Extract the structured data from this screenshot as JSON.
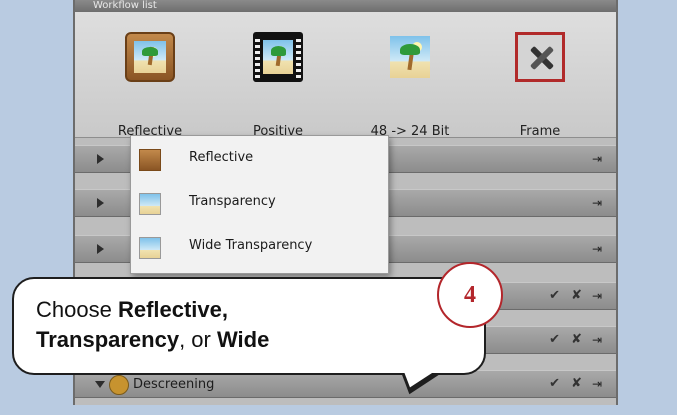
{
  "header": {
    "title": "Workflow list"
  },
  "toolbar": {
    "items": [
      {
        "label": "Reflective",
        "icon": "reflective-icon"
      },
      {
        "label": "Positive",
        "icon": "film-positive-icon"
      },
      {
        "label": "48 -> 24 Bit",
        "icon": "bit-depth-icon"
      },
      {
        "label": "Frame",
        "icon": "frame-tools-icon"
      }
    ]
  },
  "menu": {
    "items": [
      {
        "label": "Reflective"
      },
      {
        "label": "Transparency"
      },
      {
        "label": "Wide Transparency"
      }
    ]
  },
  "rows": [
    {
      "label": ""
    },
    {
      "label": ""
    },
    {
      "label": ""
    },
    {
      "label": ""
    },
    {
      "label": ""
    },
    {
      "label": "Descreening"
    }
  ],
  "glyphs": {
    "check": "✔",
    "cross": "✘",
    "export": "⇥"
  },
  "callout": {
    "prefix": "Choose ",
    "reflective": "Reflective,",
    "transparency": "Transparency",
    "mid": ", or ",
    "wide": "Wide"
  },
  "step_badge": "4",
  "colors": {
    "page_bg": "#b9cbe1",
    "badge_red": "#b3262b"
  }
}
